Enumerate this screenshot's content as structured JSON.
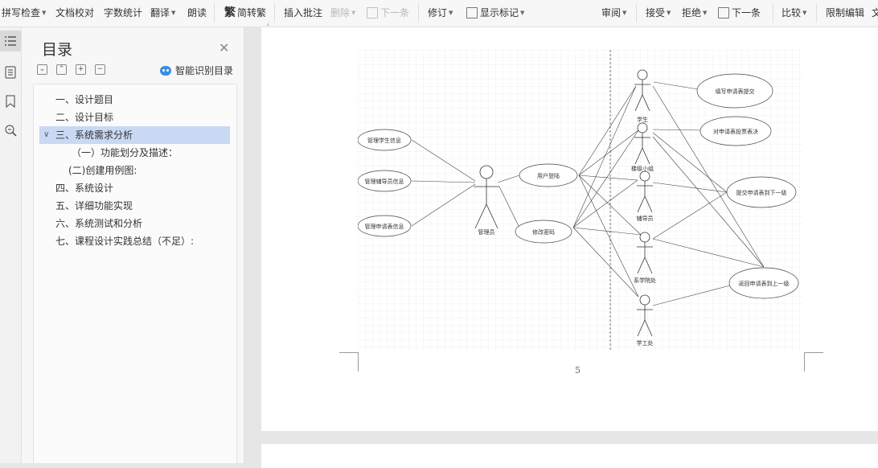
{
  "toolbar": {
    "spell_check": "拼写检查",
    "doc_proofread": "文档校对",
    "word_count": "字数统计",
    "translate": "翻译",
    "read_aloud": "朗读",
    "simp_trad": "简转繁",
    "insert_comment": "插入批注",
    "delete": "删除",
    "next_item": "下一条",
    "revise": "修订",
    "show_markup": "显示标记",
    "review": "审阅",
    "accept": "接受",
    "reject": "拒绝",
    "next_change": "下一条",
    "compare": "比较",
    "restrict_editing": "限制编辑",
    "doc_permission": "文"
  },
  "toc": {
    "title": "目录",
    "smart_label": "智能识别目录",
    "items": [
      {
        "label": "一、设计题目"
      },
      {
        "label": "二、设计目标"
      },
      {
        "label": "三、系统需求分析"
      },
      {
        "label": "（一）功能划分及描述："
      },
      {
        "label": "(二)创建用例图:"
      },
      {
        "label": "四、系统设计"
      },
      {
        "label": "五、详细功能实现"
      },
      {
        "label": "六、系统测试和分析"
      },
      {
        "label": "七、课程设计实践总结（不足）:"
      }
    ]
  },
  "document": {
    "page_number": "5",
    "diagram": {
      "actors": [
        "管理员",
        "学生",
        "楼级小组",
        "辅导员",
        "系学院处",
        "学工处"
      ],
      "use_cases": [
        "管理学生信息",
        "管理辅导员信息",
        "管理申请表信息",
        "用户登陆",
        "修改密码",
        "填写申请表提交",
        "对申请表投票表决",
        "提交申请表到下一级",
        "返回申请表到上一级"
      ]
    }
  },
  "colors": {
    "accent": "#3a8ee6",
    "toc_selected": "#c9d9f4"
  }
}
